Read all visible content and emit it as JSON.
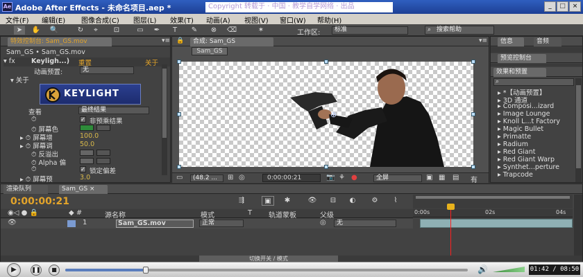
{
  "titlebar": {
    "app_title": "Adobe After Effects - 未命名项目.aep *",
    "watermark_text": "Copyright 转载于 · 中国 · 教学自学网络 · 出品"
  },
  "menubar": {
    "items": [
      "文件(F)",
      "编辑(E)",
      "图像合成(C)",
      "图层(L)",
      "效果(T)",
      "动画(A)",
      "视图(V)",
      "窗口(W)",
      "帮助(H)"
    ]
  },
  "toolbar": {
    "workspace_label": "工作区:",
    "workspace_value": "标准",
    "search_placeholder": "搜索帮助"
  },
  "effect_controls": {
    "tab_label": "特效控制台: Sam_GS.mov",
    "source_label": "Sam_GS • Sam_GS.mov",
    "effect_name": "Keyligh...)",
    "reset_label": "重置",
    "about_label": "关于",
    "preset_label": "动画预置:",
    "preset_value": "无",
    "about_row": "关于",
    "logo_text": "KEYLIGHT",
    "view_label": "查看",
    "view_value": "最终结果",
    "unpremult_label": "非预乘结果",
    "screen_colour_label": "屏幕色",
    "screen_gain_label": "屏幕增",
    "screen_gain_value": "100.0",
    "screen_balance_label": "屏幕调",
    "screen_balance_value": "50.0",
    "despill_label": "反溢出",
    "alpha_bias_label": "Alpha 偏",
    "lock_bias_label": "锁定偏差",
    "screen_pre_label": "屏幕预",
    "screen_pre_value": "3.0",
    "screen_matte_label": "屏幕蒙板",
    "screen_colour": "#2e8b3a"
  },
  "composition": {
    "tab_label": "合成: Sam_GS",
    "comp_tab": "Sam_GS",
    "zoom_value": "(48.2 ...",
    "timecode": "0:00:00:21",
    "resolution_value": "全屏",
    "extra": "有"
  },
  "right_panel": {
    "info_tab": "信息",
    "audio_tab": "音频",
    "preview_tab": "预览控制台",
    "effects_tab": "效果和预置",
    "search_placeholder": "",
    "items": [
      "*【动画预置】",
      "3D 通道",
      "Composi...izard",
      "Image Lounge",
      "Knoll L...t Factory",
      "Magic Bullet",
      "Primatte",
      "Radium",
      "Red Giant",
      "Red Giant Warp",
      "Synthet...perture",
      "Trapcode"
    ]
  },
  "timeline": {
    "render_queue_tab": "渲染队列",
    "comp_tab": "Sam_GS",
    "timecode": "0:00:00:21",
    "col_source": "源名称",
    "col_mode": "模式",
    "col_t": "T",
    "col_trkmat": "轨道蒙板",
    "col_parent": "父级",
    "layer_number": "1",
    "layer_name": "Sam_GS.mov",
    "layer_mode": "正常",
    "layer_parent": "无",
    "ruler_labels": [
      "0:00s",
      "02s",
      "04s"
    ],
    "toggle_label": "切换开关 / 模式",
    "playhead_position_fraction": 0.25
  },
  "player": {
    "time_display": "01:42 / 08:50",
    "progress_fraction": 0.2
  }
}
